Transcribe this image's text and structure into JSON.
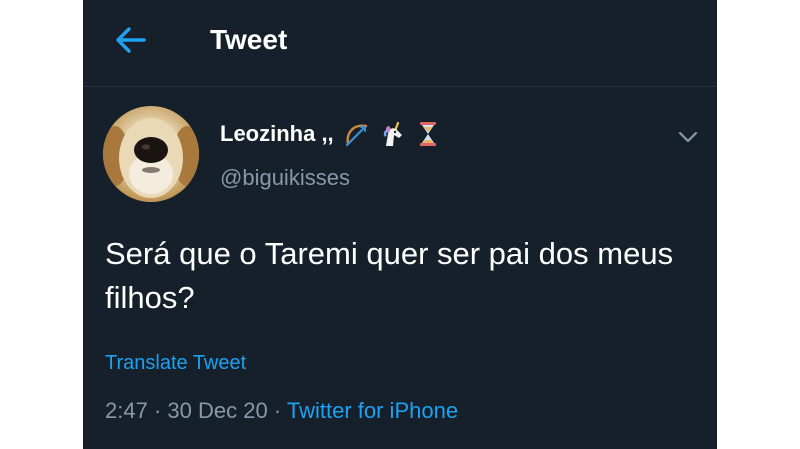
{
  "header": {
    "title": "Tweet",
    "back_icon": "arrow-left-icon"
  },
  "colors": {
    "background": "#15202b",
    "text": "#ffffff",
    "secondary_text": "#8899a6",
    "accent": "#1da1f2",
    "divider": "#25323f"
  },
  "tweet": {
    "author": {
      "display_name": "Leozinha ,,",
      "name_emojis": [
        "bow-and-arrow-icon",
        "unicorn-icon",
        "hourglass-icon"
      ],
      "handle": "@biguikisses",
      "avatar": "dog-avatar"
    },
    "text": "Será que o Taremi quer ser pai dos meus filhos?",
    "translate_label": "Translate Tweet",
    "time": "2:47",
    "separator": "·",
    "date": "30 Dec 20",
    "source": "Twitter for iPhone"
  }
}
